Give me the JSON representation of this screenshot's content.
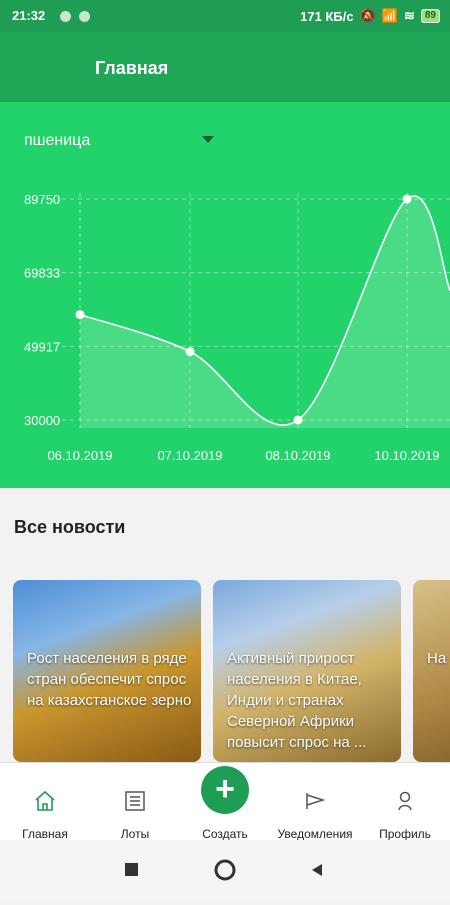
{
  "status_bar": {
    "time": "21:32",
    "network_speed": "171 КБ/с",
    "battery": "89"
  },
  "app_bar": {
    "title": "Главная"
  },
  "chart_section": {
    "dropdown_value": "пшеница",
    "colors": {
      "panel": "#22d36b",
      "line": "#ffffff"
    }
  },
  "chart_data": {
    "type": "area",
    "x": [
      "06.10.2019",
      "07.10.2019",
      "08.10.2019",
      "10.10.2019"
    ],
    "y_ticks": [
      30000,
      49917,
      69833,
      89750
    ],
    "series": [
      {
        "values": [
          58500,
          48500,
          30000,
          89750
        ]
      }
    ],
    "ylim": [
      30000,
      89750
    ]
  },
  "news": {
    "section_title": "Все новости",
    "cards": [
      {
        "text": "Рост населения в ряде стран обеспечит спрос на казахстанское зерно"
      },
      {
        "text": "Активный прирост населения в Китае, Индии и странах Северной Африки повысит спрос на ..."
      },
      {
        "text": "На ос им зе"
      }
    ]
  },
  "bottom_nav": {
    "items": [
      {
        "label": "Главная",
        "icon": "home-icon"
      },
      {
        "label": "Лоты",
        "icon": "list-icon"
      },
      {
        "label": "Создать",
        "icon": "plus-icon"
      },
      {
        "label": "Уведомления",
        "icon": "megaphone-icon"
      },
      {
        "label": "Профиль",
        "icon": "person-icon"
      }
    ],
    "active_color": "#1f9d55"
  }
}
